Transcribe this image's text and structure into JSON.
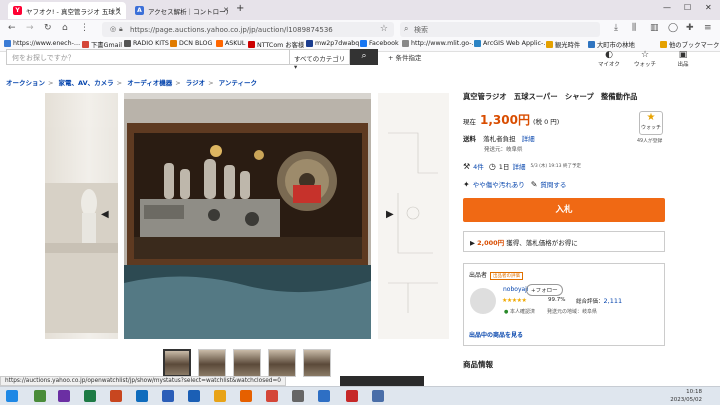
{
  "browser": {
    "tabs": [
      {
        "title": "ヤフオク! - 真空管ラジオ 五球スーパー",
        "active": true,
        "favicon_color": "#ff0033"
      },
      {
        "title": "アクセス解析｜コントロール…",
        "active": false,
        "favicon_color": "#3b6fd8"
      }
    ],
    "address": "https://page.auctions.yahoo.co.jp/jp/auction/l1089874536",
    "search_placeholder": "検索",
    "bookmarks": [
      "https://www.enech-…",
      "下書Gmail",
      "RADIO KITS",
      "DCN BLOG",
      "ASKUL",
      "NTTCom お客様",
      "mw2p7dwabq",
      "Facebook",
      "http://www.mlit.go-…",
      "ArcGIS Web Applic-…",
      "観光時件",
      "大町市の林地"
    ],
    "other_bookmarks": "他のブックマーク"
  },
  "header": {
    "search_placeholder": "何をお探しですか？",
    "category_select": "すべてのカテゴリ",
    "search_button_icon": "search-icon",
    "condition_link": "+ 条件指定",
    "icons": [
      {
        "label": "マイオク",
        "icon": "person-icon"
      },
      {
        "label": "ウォッチ",
        "icon": "star-icon"
      },
      {
        "label": "出品",
        "icon": "camera-icon"
      }
    ]
  },
  "breadcrumb": [
    "オークション",
    "家電、AV、カメラ",
    "オーディオ機器",
    "ラジオ",
    "アンティーク"
  ],
  "gallery": {
    "prev_icon": "chevron-left-icon",
    "next_icon": "chevron-right-icon",
    "thumb_count": 5
  },
  "item": {
    "title": "真空管ラジオ　五球スーパー　シャープ　整備動作品",
    "price_label": "現在",
    "price": "1,300円",
    "tax": "(税 0 円)",
    "watch_label": "ウォッチ",
    "watch_count": "49人が登録",
    "shipping_label": "送料",
    "shipping_value": "落札者負担",
    "shipping_link": "詳細",
    "origin": "発送元：岐阜県",
    "bids": "4件",
    "time_left": "1日",
    "time_link": "詳細",
    "end_time": "5/3 (木) 19:13 終了予定",
    "condition": "やや傷や汚れあり",
    "question": "質問する",
    "bid_button": "入札",
    "coupon_amount": "2,000円",
    "coupon_text": "獲得、落札価格がお得に"
  },
  "seller": {
    "label": "出品者",
    "badge": "出品者の評価",
    "name": "noboyaji",
    "follow": "+フォロー",
    "stars": "★★★★★",
    "rating_pct": "99.7%",
    "total_label": "総合評価：",
    "total": "2,111",
    "identity": "本人確認済",
    "region": "発送元の地域：岐阜県",
    "items_link": "出品中の商品を見る"
  },
  "section": {
    "product_info": "商品情報"
  },
  "status_url": "https://auctions.yahoo.co.jp/openwatchlist/jp/show/mystatus?select=watchlist&watchclosed=0",
  "clock": {
    "time": "10:18",
    "date": "2023/05/02"
  }
}
